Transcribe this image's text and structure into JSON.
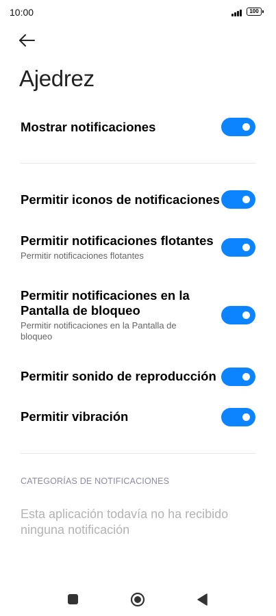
{
  "status_bar": {
    "time": "10:00",
    "battery": "100"
  },
  "page": {
    "title": "Ajedrez"
  },
  "settings": [
    {
      "title": "Mostrar notificaciones",
      "subtitle": ""
    },
    {
      "title": "Permitir iconos de notificaciones",
      "subtitle": ""
    },
    {
      "title": "Permitir notificaciones flotantes",
      "subtitle": "Permitir notificaciones flotantes"
    },
    {
      "title": "Permitir notificaciones en la Pantalla de bloqueo",
      "subtitle": "Permitir notificaciones en la Pantalla de bloqueo"
    },
    {
      "title": "Permitir sonido de reproducción",
      "subtitle": ""
    },
    {
      "title": "Permitir vibración",
      "subtitle": ""
    }
  ],
  "categories": {
    "header": "CATEGORÍAS DE NOTIFICACIONES",
    "empty_message": "Esta aplicación todavía no ha recibido ninguna notificación"
  },
  "colors": {
    "accent": "#0d84ff",
    "header": "#8a8aa3",
    "muted": "#b3b3b3"
  },
  "icons": {
    "back": "arrow-left-icon",
    "nav_recents": "square-icon",
    "nav_home": "circle-icon",
    "nav_back": "triangle-left-icon"
  }
}
